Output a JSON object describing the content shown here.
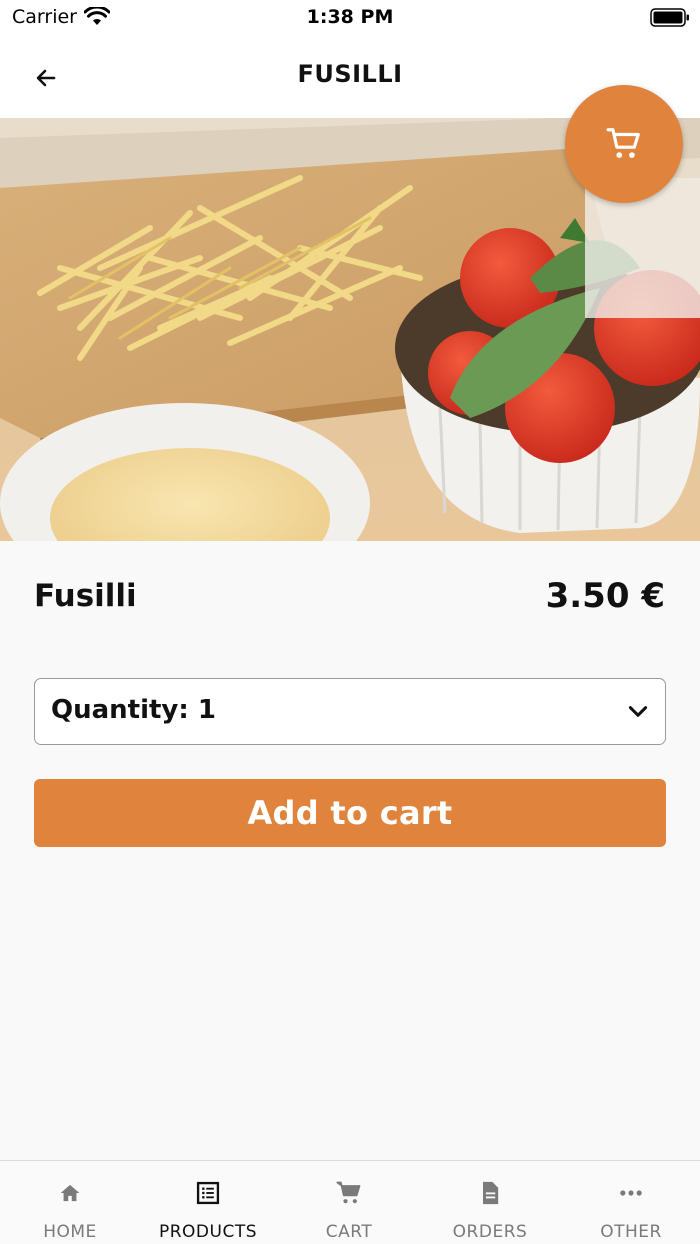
{
  "status_bar": {
    "carrier": "Carrier",
    "time": "1:38 PM"
  },
  "nav": {
    "title": "FUSILLI",
    "back_icon": "arrow-left-icon"
  },
  "hero": {
    "image": "fusilli-pasta-with-tomatoes-photo",
    "page_count": 1,
    "active_page": 1
  },
  "fab": {
    "icon": "cart-icon"
  },
  "product": {
    "name": "Fusilli",
    "price": "3.50 €",
    "quantity_label": "Quantity: 1",
    "add_button": "Add to cart"
  },
  "tabs": [
    {
      "label": "HOME",
      "icon": "home-icon",
      "active": false
    },
    {
      "label": "PRODUCTS",
      "icon": "list-icon",
      "active": true
    },
    {
      "label": "CART",
      "icon": "cart-icon",
      "active": false
    },
    {
      "label": "ORDERS",
      "icon": "document-icon",
      "active": false
    },
    {
      "label": "OTHER",
      "icon": "more-icon",
      "active": false
    }
  ],
  "colors": {
    "accent": "#e0833d",
    "background": "#f9f9f9",
    "active_tab": "#111111",
    "inactive_tab": "#7a7a7a"
  }
}
